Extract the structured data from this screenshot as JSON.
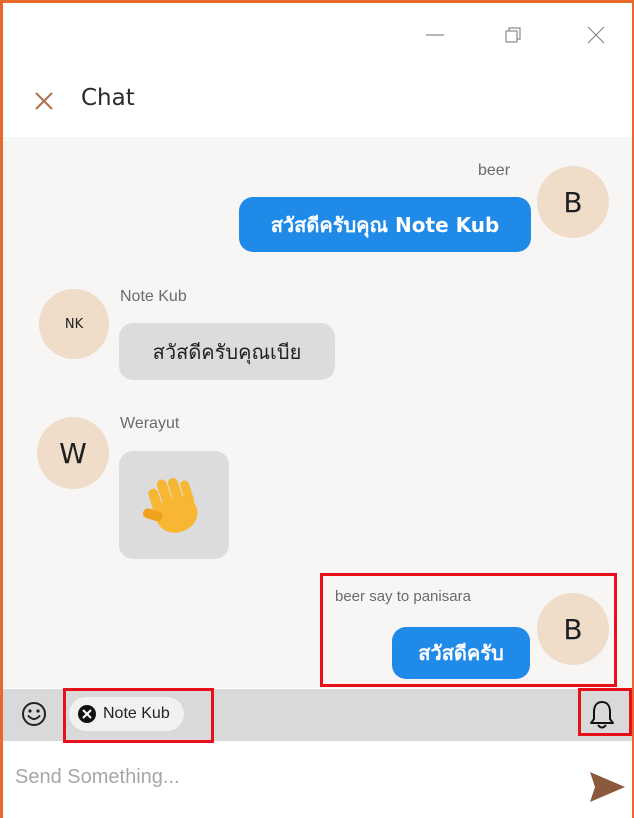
{
  "window": {
    "controls": {
      "minimize": "minimize-icon",
      "restore": "restore-icon",
      "close": "close-icon"
    }
  },
  "header": {
    "title": "Chat",
    "close_icon": "close-icon"
  },
  "messages": [
    {
      "sender": "beer",
      "avatar": "B",
      "text": "สวัสดีครับคุณ Note Kub",
      "side": "right"
    },
    {
      "sender": "Note Kub",
      "avatar": "NK",
      "text": "สวัสดีครับคุณเบีย",
      "side": "left"
    },
    {
      "sender": "Werayut",
      "avatar": "W",
      "sticker": "waving-hand",
      "side": "left"
    },
    {
      "sender": "beer say to panisara",
      "avatar": "B",
      "text": "สวัสดีครับ",
      "side": "right"
    }
  ],
  "recipient": {
    "chip_label": "Note Kub"
  },
  "composer": {
    "placeholder": "Send Something..."
  },
  "colors": {
    "accent": "#e8682d",
    "bubble_mine": "#1f8ae8",
    "bubble_theirs": "#dcdcdc",
    "avatar_bg": "#efdcc9",
    "highlight": "#e8111b",
    "send_icon": "#8b5a3c"
  }
}
